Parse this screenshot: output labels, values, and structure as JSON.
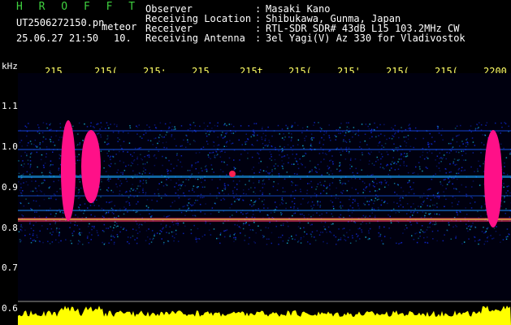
{
  "header": {
    "app_name": "H R O F F T",
    "filename": "UT2506272150.pn",
    "meteor_label": "meteor",
    "datetime": "25.06.27 21:50",
    "interval": "10.",
    "observer_label": "Observer",
    "location_label": "Receiving Location",
    "receiver_label": "Receiver",
    "antenna_label": "Receiving Antenna",
    "sep": ":",
    "observer": "Masaki Kano",
    "location": "Shibukawa, Gunma, Japan",
    "receiver": "RTL-SDR SDR# 43dB L15 103.2MHz CW",
    "antenna": "3el Yagi(V) Az 330 for Vladivostok"
  },
  "axis": {
    "unit": "kHz",
    "y_ticks": [
      "1.1",
      "1.0",
      "0.9",
      "0.8",
      "0.7",
      "0.6"
    ],
    "time_ticks": [
      "215",
      "215(",
      "215:",
      "215.",
      "215t",
      "215(",
      "215'",
      "215(",
      "215(",
      "2200"
    ]
  },
  "colors": {
    "background": "#000010",
    "weak": "#1530ff",
    "medium": "#19d6ff",
    "strong": "#ff1080",
    "amplitude": "#ffff00",
    "axis_text": "#ffffff",
    "tick_text": "#ffff66"
  }
}
